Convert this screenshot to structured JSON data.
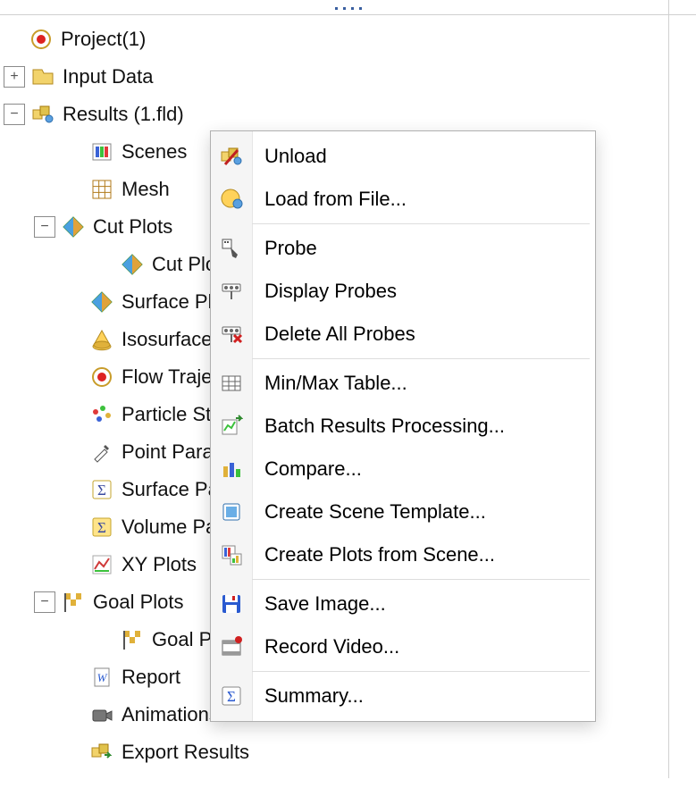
{
  "tree": {
    "root": "Project(1)",
    "items": [
      {
        "label": "Input Data"
      },
      {
        "label": "Results (1.fld)"
      },
      {
        "label": "Scenes"
      },
      {
        "label": "Mesh"
      },
      {
        "label": "Cut Plots"
      },
      {
        "label": "Cut Plot"
      },
      {
        "label": "Surface Plots"
      },
      {
        "label": "Isosurfaces"
      },
      {
        "label": "Flow Trajectories"
      },
      {
        "label": "Particle Study"
      },
      {
        "label": "Point Parameters"
      },
      {
        "label": "Surface Parameters"
      },
      {
        "label": "Volume Parameters"
      },
      {
        "label": "XY Plots"
      },
      {
        "label": "Goal Plots"
      },
      {
        "label": "Goal Plot"
      },
      {
        "label": "Report"
      },
      {
        "label": "Animations"
      },
      {
        "label": "Export Results"
      }
    ]
  },
  "context_menu": {
    "items": [
      {
        "label": "Unload",
        "icon": "unload-icon"
      },
      {
        "label": "Load from File...",
        "icon": "load-file-icon"
      },
      {
        "sep": true
      },
      {
        "label": "Probe",
        "icon": "probe-icon"
      },
      {
        "label": "Display Probes",
        "icon": "display-probes-icon"
      },
      {
        "label": "Delete All Probes",
        "icon": "delete-probes-icon"
      },
      {
        "sep": true
      },
      {
        "label": "Min/Max Table...",
        "icon": "minmax-table-icon"
      },
      {
        "label": "Batch Results Processing...",
        "icon": "batch-results-icon"
      },
      {
        "label": "Compare...",
        "icon": "compare-icon"
      },
      {
        "label": "Create Scene Template...",
        "icon": "scene-template-icon"
      },
      {
        "label": "Create Plots from Scene...",
        "icon": "plots-from-scene-icon"
      },
      {
        "sep": true
      },
      {
        "label": "Save Image...",
        "icon": "save-image-icon"
      },
      {
        "label": "Record Video...",
        "icon": "record-video-icon"
      },
      {
        "sep": true
      },
      {
        "label": "Summary...",
        "icon": "summary-icon"
      }
    ]
  }
}
